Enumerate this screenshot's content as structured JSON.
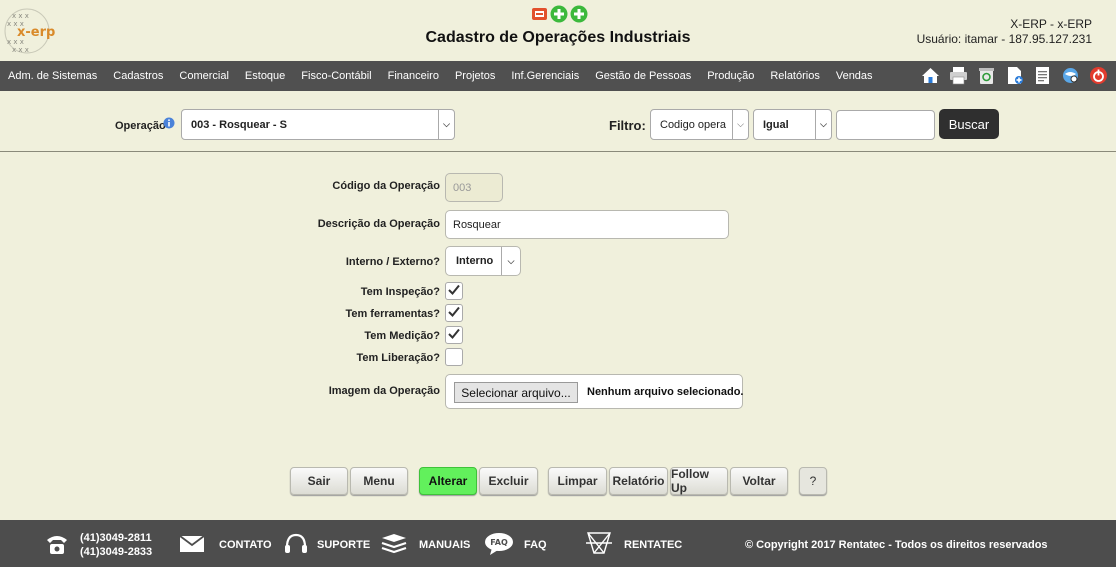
{
  "header": {
    "logo_text": "x-erp",
    "title": "Cadastro de Operações Industriais",
    "user_line1": "X-ERP - x-ERP",
    "user_line2": "Usuário: itamar - 187.95.127.231"
  },
  "menu": {
    "items": [
      "Adm. de Sistemas",
      "Cadastros",
      "Comercial",
      "Estoque",
      "Fisco-Contábil",
      "Financeiro",
      "Projetos",
      "Inf.Gerenciais",
      "Gestão de Pessoas",
      "Produção",
      "Relatórios",
      "Vendas"
    ],
    "tool_icons": [
      "home-icon",
      "print-icon",
      "recycle-icon",
      "new-doc-icon",
      "document-icon",
      "search-web-icon",
      "power-icon"
    ]
  },
  "operation_bar": {
    "label": "Operação",
    "selected": "003 - Rosquear - S",
    "filter_label": "Filtro:",
    "filter_field": "Codigo opera",
    "filter_operator": "Igual",
    "filter_value": "",
    "search_label": "Buscar"
  },
  "form": {
    "codigo_label": "Código da Operação",
    "codigo_value": "003",
    "descricao_label": "Descrição da Operação",
    "descricao_value": "Rosquear",
    "interno_label": "Interno / Externo?",
    "interno_value": "Interno",
    "checks": [
      {
        "label": "Tem Inspeção?",
        "checked": true
      },
      {
        "label": "Tem ferramentas?",
        "checked": true
      },
      {
        "label": "Tem Medição?",
        "checked": true
      },
      {
        "label": "Tem Liberação?",
        "checked": false
      }
    ],
    "imagem_label": "Imagem da Operação",
    "file_button": "Selecionar arquivo...",
    "file_status": "Nenhum arquivo selecionado."
  },
  "actions": {
    "sair": "Sair",
    "menu": "Menu",
    "alterar": "Alterar",
    "excluir": "Excluir",
    "limpar": "Limpar",
    "relatorio": "Relatório",
    "followup": "Follow Up",
    "voltar": "Voltar",
    "help": "?"
  },
  "footer": {
    "phone1": "(41)3049-2811",
    "phone2": "(41)3049-2833",
    "contato": "CONTATO",
    "suporte": "SUPORTE",
    "manuais": "MANUAIS",
    "faq": "FAQ",
    "faq_icon_text": "FAQ",
    "rentatec": "RENTATEC",
    "copyright": "© Copyright 2017 Rentatec - Todos os direitos reservados"
  },
  "colors": {
    "background": "#f0f0dc",
    "menubar": "#505050",
    "alterar_button": "#62f05c",
    "footer": "#4d4d4d"
  }
}
